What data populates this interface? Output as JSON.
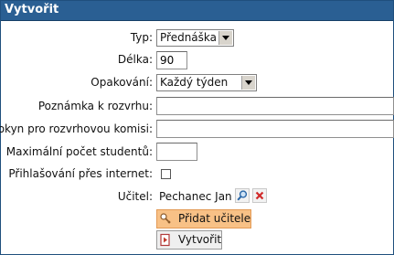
{
  "form": {
    "title": "Vytvořit",
    "type_label": "Typ:",
    "type_value": "Přednáška",
    "length_label": "Délka:",
    "length_value": "90",
    "repeat_label": "Opakování:",
    "repeat_value": "Každý týden",
    "schedule_note_label": "Poznámka k rozvrhu:",
    "schedule_note_value": "",
    "committee_label": "Pokyn pro rozvrhovou komisi:",
    "committee_value": "",
    "max_students_label": "Maximální počet studentů:",
    "max_students_value": "",
    "internet_signup_label": "Přihlašování přes internet:",
    "internet_signup_checked": false,
    "teacher_label": "Učitel:",
    "teacher_name": "Pechanec Jan",
    "add_teacher_label": "Přidat učitele",
    "create_label": "Vytvořit"
  },
  "icons": {
    "dropdown": "chevron-down-icon",
    "search": "magnifier-icon",
    "remove": "red-x-icon",
    "add_teacher": "key-icon",
    "create": "document-arrow-icon"
  },
  "colors": {
    "header_bg": "#2a5f93",
    "header_text": "#ffffff",
    "add_teacher_bg": "#f8c186",
    "remove_icon": "#d12a2a"
  }
}
